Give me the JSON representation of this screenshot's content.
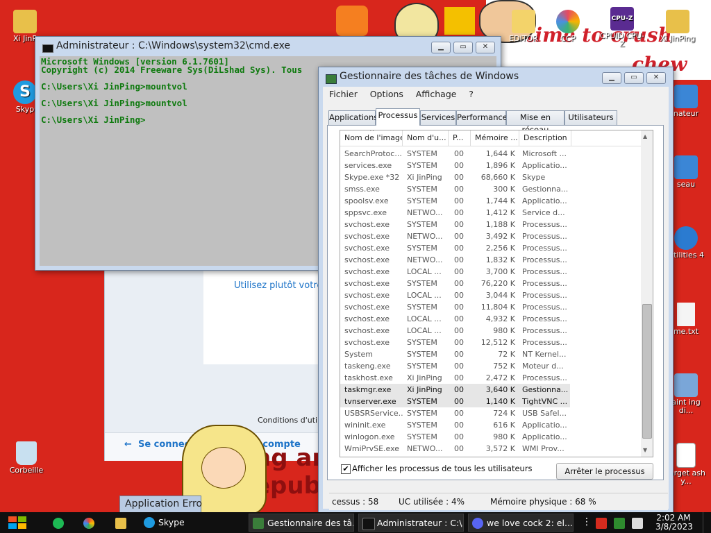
{
  "desktop": {
    "icons_left": [
      {
        "label": "Xi JinP",
        "icon": "user-folder-icon",
        "color": "#e8c04a"
      },
      {
        "label": "Skyp",
        "icon": "skype-icon",
        "color": "#1f9be0"
      },
      {
        "label": "Corbeille",
        "icon": "recycle-bin-icon",
        "color": "#c8e0f0"
      }
    ],
    "icons_right": [
      {
        "label": "EDITOR",
        "icon": "editor-icon"
      },
      {
        "label": "CCP",
        "icon": "ccp-icon"
      },
      {
        "label": "CPUID CPU-Z",
        "icon": "cpuz-icon"
      },
      {
        "label": "Xi JinPing",
        "icon": "user-folder-icon"
      },
      {
        "label": "nateur",
        "icon": "computer-icon"
      },
      {
        "label": "seau",
        "icon": "network-icon"
      },
      {
        "label": "Utilities 4",
        "icon": "utilities-icon"
      },
      {
        "label": "me.txt",
        "icon": "text-file-icon"
      },
      {
        "label": "aint ing di...",
        "icon": "paint-icon"
      },
      {
        "label": "forget ash y...",
        "icon": "doc-file-icon"
      }
    ],
    "background_snippets": {
      "login_hint": "Utilisez plutôt votre",
      "terms": "Conditions d'utili",
      "connect": "Se connecte",
      "connect_suffix": "e compte",
      "wallpaper_top": "s time to crush",
      "wallpaper_top2": "chew",
      "wallpaper_bottom1": "ng and",
      "wallpaper_bottom2": "epubli"
    }
  },
  "cmd": {
    "title": "Administrateur : C:\\Windows\\system32\\cmd.exe",
    "lines": [
      "Microsoft Windows [version 6.1.7601]",
      "Copyright (c) 2014 Freeware Sys(DiLshad Sys). Tous",
      "",
      "C:\\Users\\Xi JinPing>mountvol",
      "",
      "C:\\Users\\Xi JinPing>mountvol",
      "",
      "C:\\Users\\Xi JinPing>"
    ]
  },
  "taskmgr": {
    "title": "Gestionnaire des tâches de Windows",
    "menu": [
      "Fichier",
      "Options",
      "Affichage",
      "?"
    ],
    "tabs": [
      "Applications",
      "Processus",
      "Services",
      "Performance",
      "Mise en réseau",
      "Utilisateurs"
    ],
    "active_tab": "Processus",
    "columns": [
      "Nom de l'image",
      "Nom d'u...",
      "P...",
      "Mémoire ...",
      "Description"
    ],
    "rows": [
      [
        "SearchProtoc...",
        "SYSTEM",
        "00",
        "1,644 K",
        "Microsoft ..."
      ],
      [
        "services.exe",
        "SYSTEM",
        "00",
        "1,896 K",
        "Applicatio..."
      ],
      [
        "Skype.exe *32",
        "Xi JinPing",
        "00",
        "68,660 K",
        "Skype"
      ],
      [
        "smss.exe",
        "SYSTEM",
        "00",
        "300 K",
        "Gestionna..."
      ],
      [
        "spoolsv.exe",
        "SYSTEM",
        "00",
        "1,744 K",
        "Applicatio..."
      ],
      [
        "sppsvc.exe",
        "NETWO...",
        "00",
        "1,412 K",
        "Service d..."
      ],
      [
        "svchost.exe",
        "SYSTEM",
        "00",
        "1,188 K",
        "Processus..."
      ],
      [
        "svchost.exe",
        "NETWO...",
        "00",
        "3,492 K",
        "Processus..."
      ],
      [
        "svchost.exe",
        "SYSTEM",
        "00",
        "2,256 K",
        "Processus..."
      ],
      [
        "svchost.exe",
        "NETWO...",
        "00",
        "1,832 K",
        "Processus..."
      ],
      [
        "svchost.exe",
        "LOCAL ...",
        "00",
        "3,700 K",
        "Processus..."
      ],
      [
        "svchost.exe",
        "SYSTEM",
        "00",
        "76,220 K",
        "Processus..."
      ],
      [
        "svchost.exe",
        "LOCAL ...",
        "00",
        "3,044 K",
        "Processus..."
      ],
      [
        "svchost.exe",
        "SYSTEM",
        "00",
        "11,804 K",
        "Processus..."
      ],
      [
        "svchost.exe",
        "LOCAL ...",
        "00",
        "4,932 K",
        "Processus..."
      ],
      [
        "svchost.exe",
        "LOCAL ...",
        "00",
        "980 K",
        "Processus..."
      ],
      [
        "svchost.exe",
        "SYSTEM",
        "00",
        "12,512 K",
        "Processus..."
      ],
      [
        "System",
        "SYSTEM",
        "00",
        "72 K",
        "NT Kernel..."
      ],
      [
        "taskeng.exe",
        "SYSTEM",
        "00",
        "752 K",
        "Moteur d..."
      ],
      [
        "taskhost.exe",
        "Xi JinPing",
        "00",
        "2,472 K",
        "Processus..."
      ],
      [
        "taskmgr.exe",
        "Xi JinPing",
        "00",
        "3,640 K",
        "Gestionna..."
      ],
      [
        "tvnserver.exe",
        "SYSTEM",
        "00",
        "1,140 K",
        "TightVNC ..."
      ],
      [
        "USBSRService...",
        "SYSTEM",
        "00",
        "724 K",
        "USB Safel..."
      ],
      [
        "wininit.exe",
        "SYSTEM",
        "00",
        "616 K",
        "Applicatio..."
      ],
      [
        "winlogon.exe",
        "SYSTEM",
        "00",
        "980 K",
        "Applicatio..."
      ],
      [
        "WmiPrvSE.exe",
        "NETWO...",
        "00",
        "3,572 K",
        "WMI Prov..."
      ]
    ],
    "selected_rows": [
      20,
      21
    ],
    "show_all_label": "Afficher les processus de tous les utilisateurs",
    "show_all_checked": true,
    "end_process_label": "Arrêter le processus",
    "status": {
      "processes": "cessus : 58",
      "cpu": "UC utilisée : 4%",
      "memory": "Mémoire physique : 68 %"
    }
  },
  "error_window": {
    "title": "Application Erro"
  },
  "taskbar": {
    "items": [
      {
        "label": "Skype",
        "icon": "skype-icon"
      },
      {
        "label": "Gestionnaire des tâ...",
        "icon": "taskmgr-icon"
      },
      {
        "label": "Administrateur : C:\\...",
        "icon": "cmd-icon"
      },
      {
        "label": "we love cock 2: el...",
        "icon": "discord-icon"
      }
    ],
    "clock_time": "2:02 AM",
    "clock_date": "3/8/2023"
  }
}
